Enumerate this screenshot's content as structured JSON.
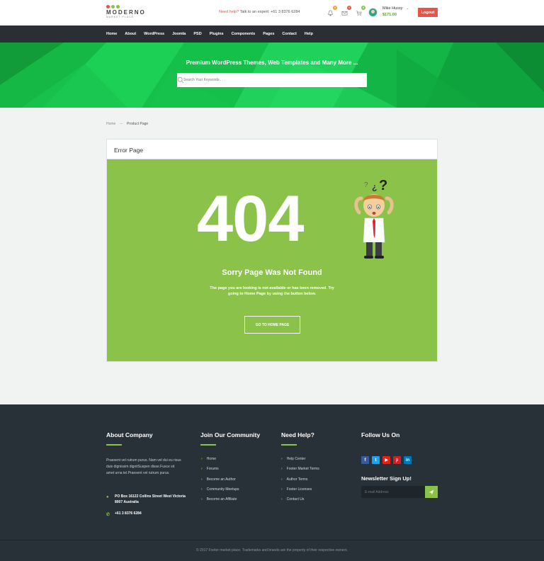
{
  "header": {
    "logo_name": "MODERNO",
    "logo_sub": "MARKET PLACE",
    "logo_dot_colors": [
      "#e8534a",
      "#8bc34a",
      "#8bc34a"
    ],
    "help_label": "Need help?",
    "help_text": "Talk to an expert: +61 3 8376 6284",
    "badges": {
      "notifications": "0",
      "messages": "0",
      "cart": "0"
    },
    "user_name": "Mike Hussy",
    "user_amount": "$171.00",
    "logout_label": "Logout"
  },
  "nav": [
    "Home",
    "About",
    "WordPress",
    "Joomla",
    "PSD",
    "Plugins",
    "Components",
    "Pages",
    "Contact",
    "Help"
  ],
  "hero": {
    "title": "Premium WordPress Themes, Web Templates and Many More ...",
    "search_placeholder": "Search Your Keywords . . ."
  },
  "breadcrumb": {
    "home": "Home",
    "separator": "–",
    "current": "Product Page"
  },
  "error": {
    "card_title": "Error Page",
    "code": "404",
    "heading": "Sorry Page Was Not Found",
    "message": "The page you are looking is not available or has been removed. Try going to Home Page by using the button below.",
    "button": "GO TO HOME PAGE"
  },
  "footer": {
    "about_title": "About Company",
    "about_text": "Praesent vel rutrum purus. Nam vel dui eu risus duis dignissim dignitSuspen disse.Fusce sit amet urna tel.Praesent vel rutrum purus.",
    "address": "PO Box 16122 Collins Street West Victoria 8007 Australia",
    "phone": "+61 3 8376 6284",
    "community_title": "Join Our Community",
    "community_links": [
      "Home",
      "Forums",
      "Become an Author",
      "Community Meetups",
      "Become an Affiliate"
    ],
    "help_title": "Need Help?",
    "help_links": [
      "Help Center",
      "Footer Market Terms",
      "Author Terms",
      "Footer Licenses",
      "Contact Us"
    ],
    "follow_title": "Follow Us On",
    "social_colors": {
      "facebook": "#3b5998",
      "twitter": "#1da1f2",
      "youtube": "#e62117",
      "pinterest": "#cb2027",
      "linkedin": "#0077b5"
    },
    "newsletter_title": "Newsletter Sign Up!",
    "email_placeholder": "E-mail Address",
    "copyright": "© 2017 Footer market place. Trademarks and brands are the property of their respective owners."
  },
  "colors": {
    "accent_green": "#8bc34a",
    "danger": "#e8534a",
    "nav_bg": "#2b2f34",
    "footer_bg": "#283138"
  }
}
